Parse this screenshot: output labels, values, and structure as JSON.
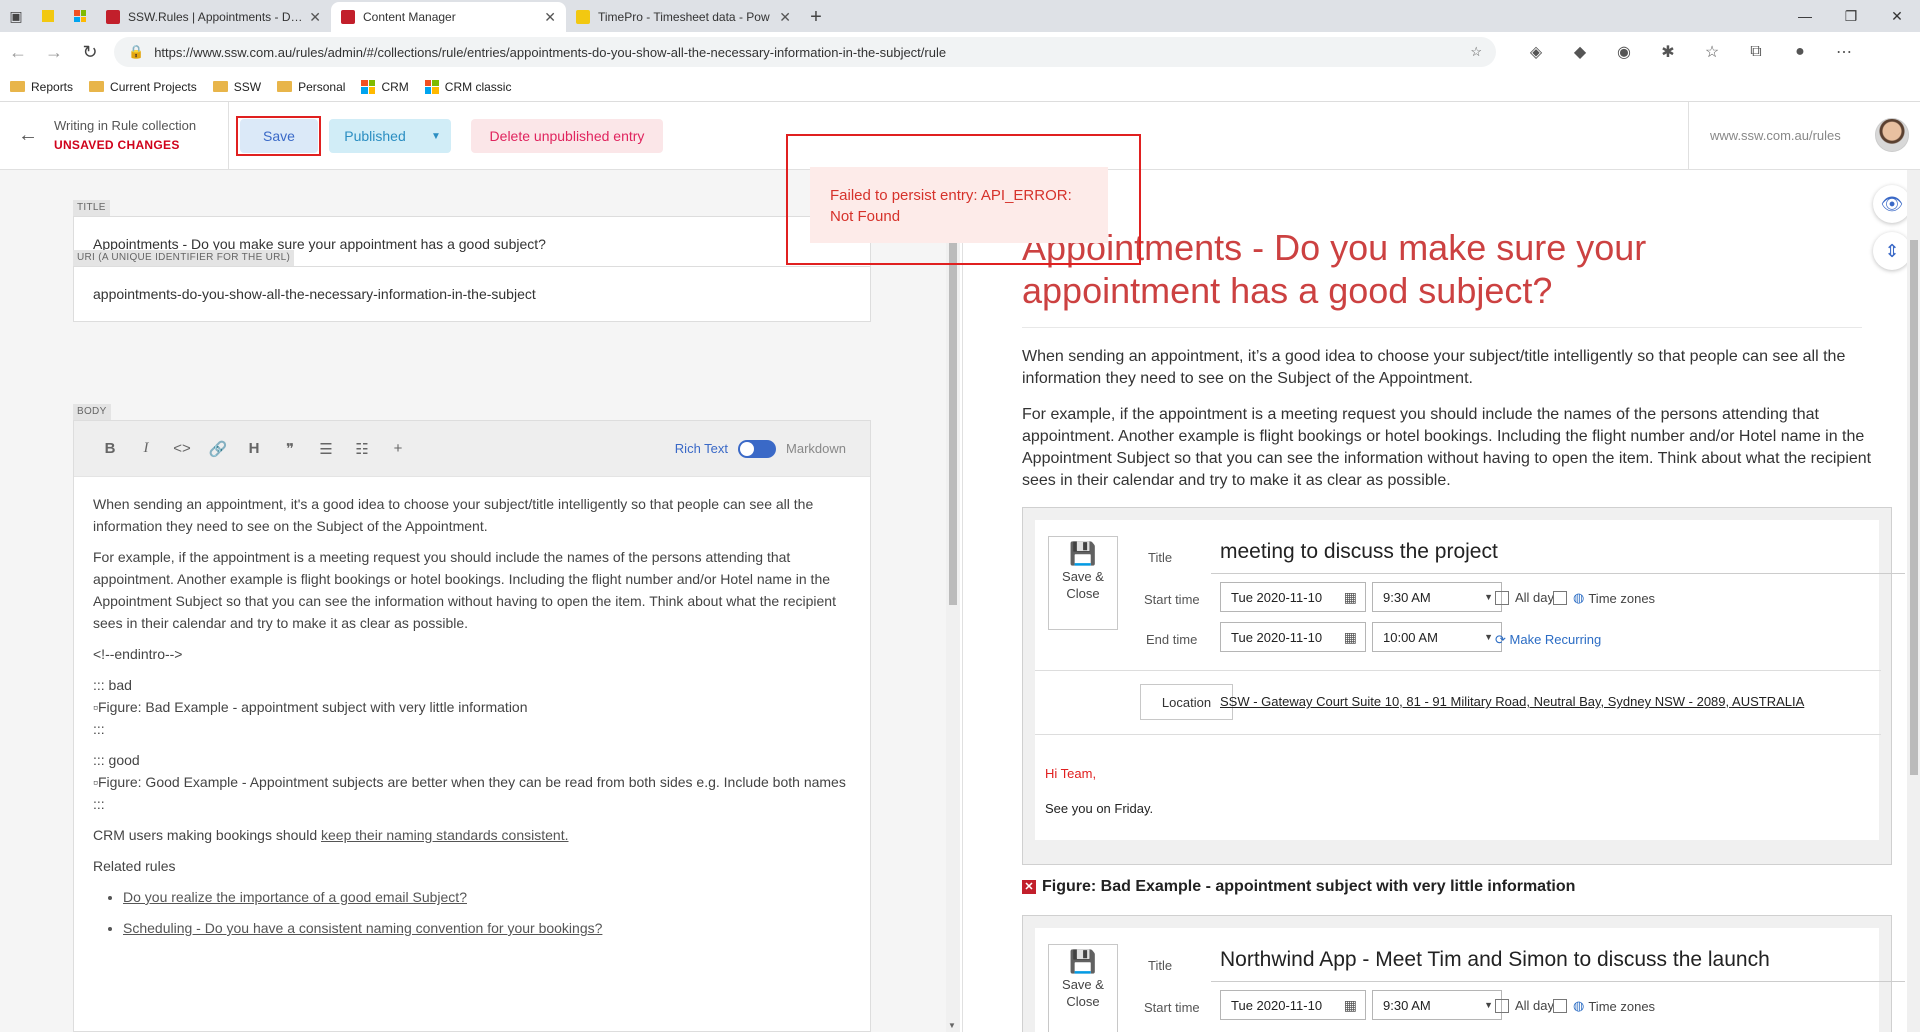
{
  "browser": {
    "tabs": [
      {
        "title": "SSW.Rules | Appointments - Do y",
        "active": false,
        "favicon_color": "#c21f2b"
      },
      {
        "title": "Content Manager",
        "active": true,
        "favicon_color": "#c21f2b"
      },
      {
        "title": "TimePro - Timesheet data - Pow",
        "active": false,
        "favicon_color": "#f2c811"
      }
    ],
    "new_tab": "+",
    "url": "https://www.ssw.com.au/rules/admin/#/collections/rule/entries/appointments-do-you-show-all-the-necessary-information-in-the-subject/rule",
    "bookmarks": [
      {
        "label": "Reports",
        "type": "folder"
      },
      {
        "label": "Current Projects",
        "type": "folder"
      },
      {
        "label": "SSW",
        "type": "folder"
      },
      {
        "label": "Personal",
        "type": "folder"
      },
      {
        "label": "CRM",
        "type": "ms"
      },
      {
        "label": "CRM classic",
        "type": "ms"
      }
    ]
  },
  "header": {
    "collection": "Writing in Rule collection",
    "status": "UNSAVED CHANGES",
    "save_label": "Save",
    "published_label": "Published",
    "delete_label": "Delete unpublished entry",
    "site_link": "www.ssw.com.au/rules"
  },
  "toast": {
    "message": "Failed to persist entry: API_ERROR: Not Found"
  },
  "editor": {
    "title_label": "TITLE",
    "title_value": "Appointments - Do you make sure your appointment has a good subject?",
    "uri_label": "URI (A UNIQUE IDENTIFIER FOR THE URL)",
    "uri_value": "appointments-do-you-show-all-the-necessary-information-in-the-subject",
    "body_label": "BODY",
    "toolbar": {
      "bold": "B",
      "italic": "I",
      "code": "<>",
      "heading": "H",
      "quote": "❞",
      "rich_text": "Rich Text",
      "markdown": "Markdown"
    },
    "body": {
      "p1": "When sending an appointment, it's a good idea to choose your subject/title intelligently so that people can see all the information they need to see on the Subject of the Appointment.",
      "p2": "For example, if the appointment is a meeting request you should include the names of the persons attending that appointment. Another example is flight bookings or hotel bookings. Including the flight number and/or Hotel name in the Appointment Subject so that you can see the information without having to open the item. Think about what the recipient sees in their calendar and try to make it as clear as possible.",
      "endintro": "<!--endintro-->",
      "bad_open": "::: bad",
      "bad_fig": "Figure: Bad Example - appointment subject with very little information",
      "bad_close": ":::",
      "good_open": "::: good",
      "good_fig": "Figure: Good Example - Appointment subjects are better when they can be read from both sides e.g. Include both names",
      "good_close": ":::",
      "crm_prefix": "CRM users making bookings should ",
      "crm_link": "keep their naming standards consistent.",
      "related": "Related rules",
      "related_links": [
        "Do you realize the importance of a good email Subject?",
        "Scheduling - Do you have a consistent naming convention for your bookings?"
      ]
    }
  },
  "preview": {
    "title": "Appointments - Do you make sure your appointment has a good subject?",
    "p1": "When sending an appointment, it’s a good idea to choose your subject/title intelligently so that people can see all the information they need to see on the Subject of the Appointment.",
    "p2": "For example, if the appointment is a meeting request you should include the names of the persons attending that appointment. Another example is flight bookings or hotel bookings. Including the flight number and/or Hotel name in the Appointment Subject so that you can see the information without having to open the item. Think about what the recipient sees in their calendar and try to make it as clear as possible.",
    "appt1": {
      "save_close": "Save & Close",
      "title_label": "Title",
      "title": "meeting to discuss the project",
      "start_label": "Start time",
      "start_date": "Tue 2020-11-10",
      "start_time": "9:30 AM",
      "end_label": "End time",
      "end_date": "Tue 2020-11-10",
      "end_time": "10:00 AM",
      "all_day": "All day",
      "time_zones": "Time zones",
      "make_recurring": "Make Recurring",
      "location_label": "Location",
      "location": "SSW - Gateway Court Suite 10, 81 - 91 Military Road, Neutral Bay, Sydney NSW - 2089, AUSTRALIA",
      "greeting": "Hi Team,",
      "body": "See you on Friday."
    },
    "caption1": "Figure: Bad Example - appointment subject with very little information",
    "appt2": {
      "save_close": "Save & Close",
      "title_label": "Title",
      "title": "Northwind App - Meet Tim and Simon to discuss the launch",
      "start_label": "Start time",
      "start_date": "Tue 2020-11-10",
      "start_time": "9:30 AM",
      "all_day": "All day",
      "time_zones": "Time zones"
    }
  }
}
